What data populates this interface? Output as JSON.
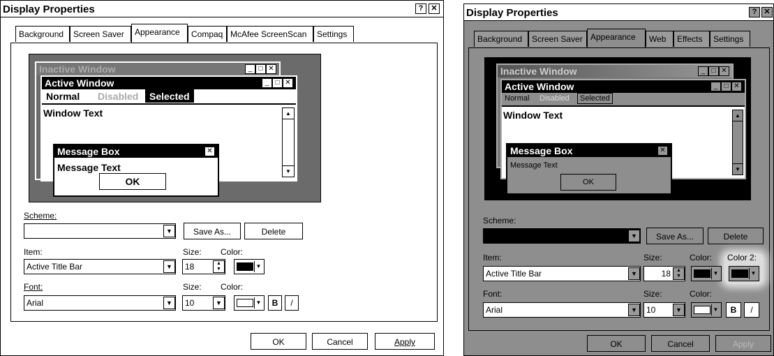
{
  "left": {
    "title": "Display Properties",
    "help_btn": "?",
    "close_btn": "✕",
    "tabs": [
      "Background",
      "Screen Saver",
      "Appearance",
      "Compaq",
      "McAfee ScreenScan",
      "Settings"
    ],
    "preview": {
      "inactive_window": "Inactive Window",
      "active_window": "Active Window",
      "menu_normal": "Normal",
      "menu_disabled": "Disabled",
      "menu_selected": "Selected",
      "window_text": "Window Text",
      "message_box": "Message Box",
      "message_text": "Message Text",
      "ok": "OK"
    },
    "scheme_label": "Scheme:",
    "scheme_value": "",
    "save_as": "Save As...",
    "delete": "Delete",
    "item_label": "Item:",
    "item_value": "Active Title Bar",
    "size_label": "Size:",
    "size_value": "18",
    "color_label": "Color:",
    "font_label": "Font:",
    "font_value": "Arial",
    "font_size_label": "Size:",
    "font_size_value": "10",
    "font_color_label": "Color:",
    "bold": "B",
    "italic": "/",
    "ok": "OK",
    "cancel": "Cancel",
    "apply": "Apply"
  },
  "right": {
    "title": "Display Properties",
    "help_btn": "?",
    "close_btn": "✕",
    "tabs": [
      "Background",
      "Screen Saver",
      "Appearance",
      "Web",
      "Effects",
      "Settings"
    ],
    "preview": {
      "inactive_window": "Inactive Window",
      "active_window": "Active Window",
      "menu_normal": "Normal",
      "menu_disabled": "Disabled",
      "menu_selected": "Selected",
      "window_text": "Window Text",
      "message_box": "Message Box",
      "message_text": "Message Text",
      "ok": "OK"
    },
    "scheme_label": "Scheme:",
    "scheme_value": "",
    "save_as": "Save As...",
    "delete": "Delete",
    "item_label": "Item:",
    "item_value": "Active Title Bar",
    "size_label": "Size:",
    "size_value": "18",
    "color_label": "Color:",
    "color2_label": "Color 2:",
    "font_label": "Font:",
    "font_value": "Arial",
    "font_size_label": "Size:",
    "font_size_value": "10",
    "font_color_label": "Color:",
    "bold": "B",
    "italic": "/",
    "ok": "OK",
    "cancel": "Cancel",
    "apply": "Apply"
  }
}
